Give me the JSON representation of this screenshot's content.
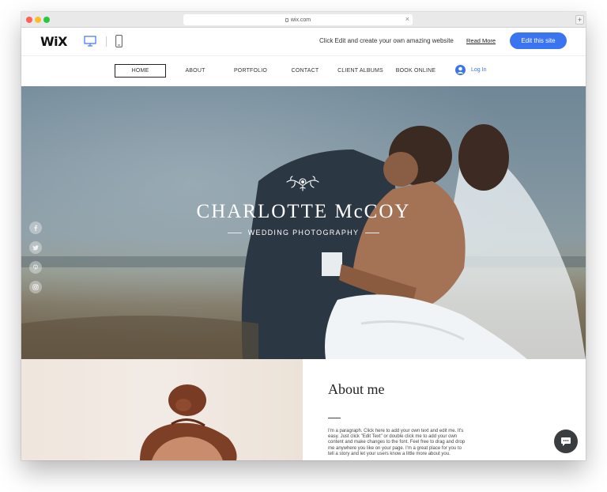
{
  "browser": {
    "url": "wix.com",
    "close_tab": "×",
    "new_tab": "+"
  },
  "wix_bar": {
    "logo": "WiX",
    "promo": "Click Edit and create your own amazing website",
    "read_more": "Read More",
    "edit_button": "Edit this site"
  },
  "nav": {
    "items": [
      {
        "label": "HOME",
        "active": true
      },
      {
        "label": "ABOUT",
        "active": false
      },
      {
        "label": "PORTFOLIO",
        "active": false
      },
      {
        "label": "CONTACT",
        "active": false
      },
      {
        "label": "CLIENT ALBUMS",
        "active": false
      },
      {
        "label": "BOOK ONLINE",
        "active": false
      }
    ],
    "login": "Log In"
  },
  "hero": {
    "title": "CHARLOTTE McCOY",
    "subtitle": "WEDDING PHOTOGRAPHY",
    "social_icons": [
      "facebook-icon",
      "twitter-icon",
      "pinterest-icon",
      "instagram-icon"
    ]
  },
  "about": {
    "title": "About me",
    "body": "I'm a paragraph. Click here to add your own text and edit me. It's easy. Just click \"Edit Text\" or double click me to add your own content and make changes to the font. Feel free to drag and drop me anywhere you like on your page. I'm a great place for you to tell a story and let your users know a little more about you."
  },
  "colors": {
    "accent": "#3a74f0",
    "chat_button": "#3a3d40"
  }
}
